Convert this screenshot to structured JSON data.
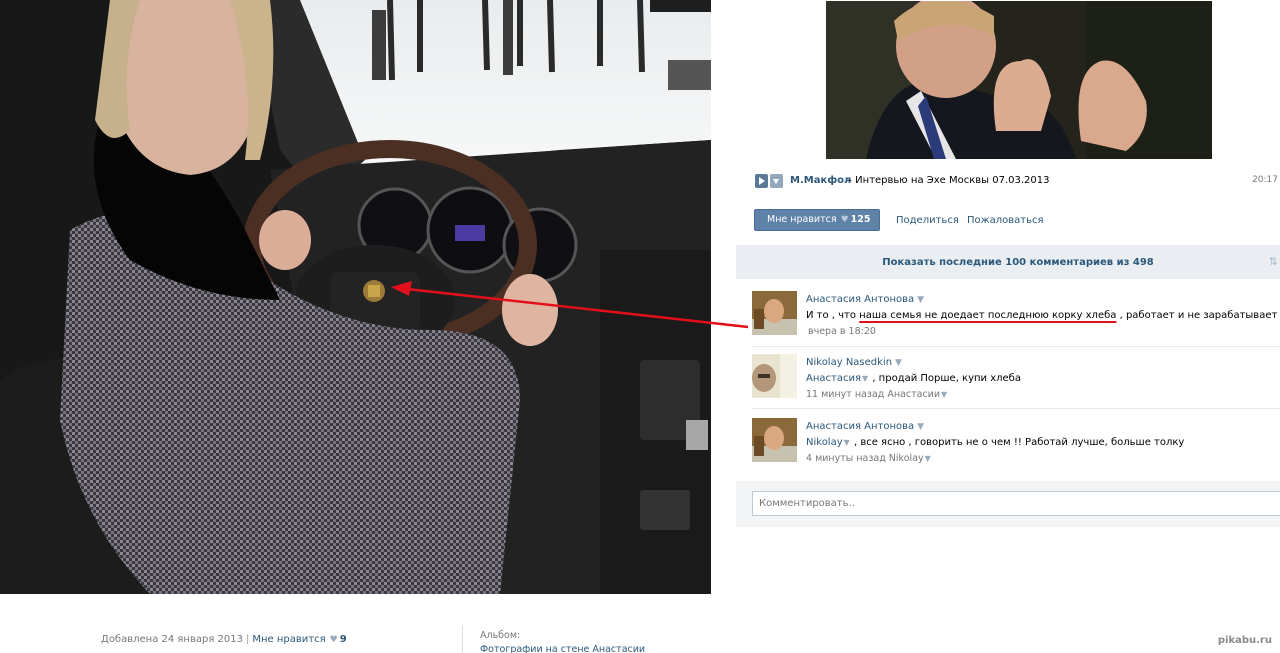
{
  "video": {
    "artist": "М.Макфол",
    "title": "– Интервью на Эхе Москвы 07.03.2013",
    "time": "20:17"
  },
  "actions": {
    "like_label": "Мне нравится",
    "like_count": "125",
    "share_label": "Поделиться",
    "report_label": "Пожаловаться"
  },
  "comments_header": {
    "show_more": "Показать последние 100 комментариев из 498"
  },
  "comments": [
    {
      "author": "Анастасия Антонова",
      "text_start": "И то , что ",
      "text_underlined": "наша семья не доедает последнюю корку хлеба",
      "text_end": " , работает и не зарабатывает !!!",
      "time": "вчера в 18:20"
    },
    {
      "author": "Nikolay Nasedkin",
      "mention": "Анастасия",
      "text": " , продай Порше, купи хлеба",
      "time": "11 минут назад Анастасии"
    },
    {
      "author": "Анастасия Антонова",
      "mention": "Nikolay",
      "text": " , все ясно , говорить не о чем !! Работай лучше, больше толку",
      "time": "4 минуты назад Nikolay"
    }
  ],
  "comment_box": {
    "placeholder": "Комментировать.."
  },
  "photo_meta": {
    "added": "Добавлена 24 января 2013",
    "separator": "|",
    "like_label": "Мне нравится",
    "like_count": "9",
    "album_label": "Альбом:",
    "album_link": "Фотографии на стене Анастасии"
  },
  "watermark": "pikabu.ru",
  "colors": {
    "link": "#2b587a",
    "like_button": "#5e82a8",
    "annotation_arrow": "#e3101c"
  },
  "icons": [
    "play-icon",
    "add-icon",
    "heart-icon",
    "dropdown-icon",
    "sort-icon"
  ]
}
